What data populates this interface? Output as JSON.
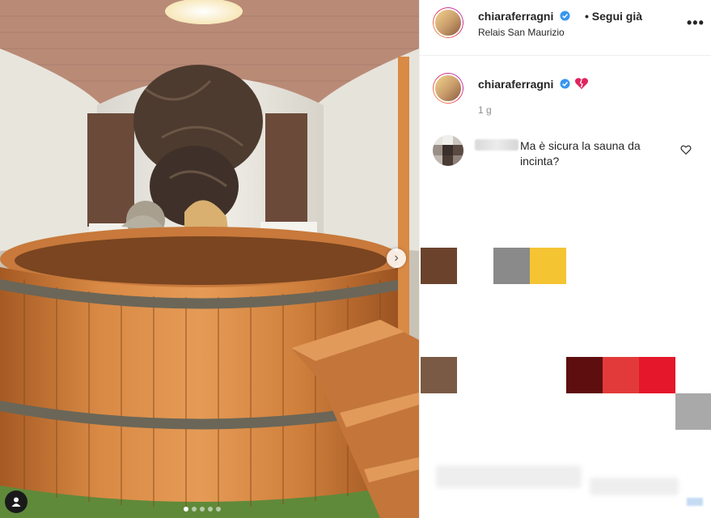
{
  "post": {
    "username": "chiaraferragni",
    "follow_label": "• Segui già",
    "location": "Relais San Maurizio",
    "more_icon": "more-options-icon",
    "caption_emoji": "broken-heart-icon",
    "time_ago": "1 g"
  },
  "carousel": {
    "slide_count": 5,
    "active_index": 0,
    "next_icon": "chevron-right-icon",
    "tag_icon": "user-tag-icon"
  },
  "comments": [
    {
      "username": "",
      "text": "Ma è sicura la sauna da incinta?"
    }
  ],
  "colors": {
    "verified_blue": "#3897f0",
    "text_primary": "#262626",
    "text_secondary": "#8e8e8e",
    "border": "#efefef"
  }
}
